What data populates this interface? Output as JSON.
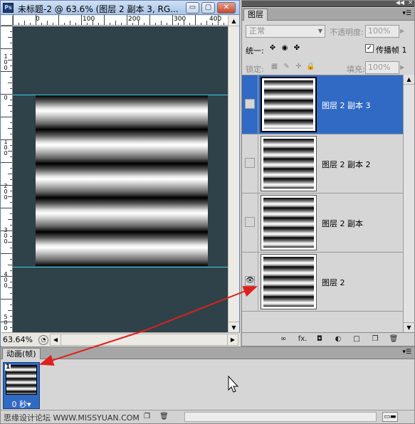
{
  "document": {
    "title": "未标题-2 @ 63.6% (图层 2 副本 3, RG...",
    "app_icon": "Ps",
    "ruler_top": [
      "0",
      "100",
      "200",
      "300",
      "400"
    ],
    "ruler_left": [
      "1\n0\n0",
      "0",
      "1\n0\n0",
      "2\n0\n0",
      "3\n0\n0",
      "4\n0\n0",
      "5\n0\n0"
    ],
    "zoom": "63.64%",
    "minimize_glyph": "▭",
    "restore_glyph": "▢",
    "close_glyph": "✕"
  },
  "layers_panel": {
    "tab": "图层",
    "collapse_glyph": "◀◀",
    "close_glyph": "✕",
    "menu_glyph": "▾☰",
    "blend_mode": "正常",
    "opacity_label": "不透明度:",
    "opacity_value": "100%",
    "unify_label": "统一:",
    "propagate_label": "传播帧 1",
    "propagate_checked": "✓",
    "lock_label": "锁定:",
    "fill_label": "填充:",
    "fill_value": "100%",
    "eye_glyph": "👁",
    "layers": [
      {
        "name": "图层 2 副本 3",
        "selected": true,
        "visible": false
      },
      {
        "name": "图层 2 副本 2",
        "selected": false,
        "visible": false
      },
      {
        "name": "图层 2 副本",
        "selected": false,
        "visible": false
      },
      {
        "name": "图层 2",
        "selected": false,
        "visible": true
      }
    ],
    "footer_icons": [
      "link-icon",
      "fx-icon",
      "mask-icon",
      "adjustment-icon",
      "group-icon",
      "new-layer-icon",
      "trash-icon"
    ],
    "footer_glyphs": [
      "∞",
      "fx.",
      "◘",
      "◐",
      "□",
      "❐",
      "🗑"
    ]
  },
  "animation_panel": {
    "tab": "动画(帧)",
    "menu_glyph": "▾☰",
    "frame_number": "1",
    "frame_delay": "0 秒▾",
    "watermark": "思缘设计论坛 WWW.MISSYUAN.COM",
    "scroll_glyph": "▭▬"
  },
  "colors": {
    "selection": "#316ac5",
    "canvas_bg": "#2f4149",
    "guide": "#3ad1e6",
    "annotation_arrow": "#e0201c"
  }
}
